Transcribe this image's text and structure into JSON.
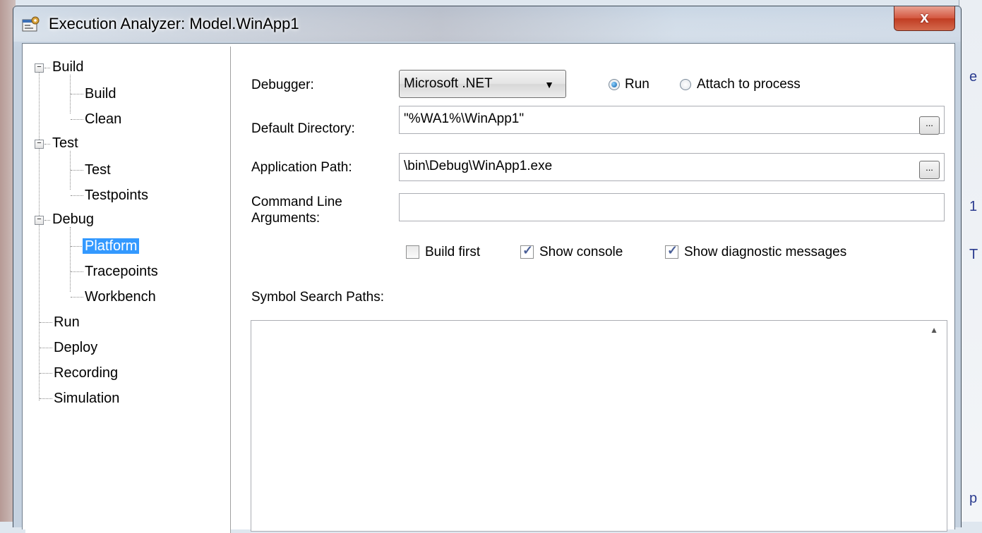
{
  "window": {
    "title": "Execution Analyzer: Model.WinApp1",
    "close_label": "x"
  },
  "tree": {
    "groups": [
      {
        "label": "Build",
        "children": [
          "Build",
          "Clean"
        ]
      },
      {
        "label": "Test",
        "children": [
          "Test",
          "Testpoints"
        ]
      },
      {
        "label": "Debug",
        "children": [
          "Platform",
          "Tracepoints",
          "Workbench"
        ]
      }
    ],
    "leaves": [
      "Run",
      "Deploy",
      "Recording",
      "Simulation"
    ],
    "selected": "Platform"
  },
  "form": {
    "debugger_label": "Debugger:",
    "debugger_value": "Microsoft .NET",
    "run_label": "Run",
    "attach_label": "Attach to process",
    "run_selected": true,
    "default_dir_label": "Default Directory:",
    "default_dir_value": "\"%WA1%\\WinApp1\"",
    "app_path_label": "Application Path:",
    "app_path_value": "\\bin\\Debug\\WinApp1.exe",
    "cmd_args_label_1": "Command Line",
    "cmd_args_label_2": "Arguments:",
    "cmd_args_value": "",
    "browse_label": "...",
    "build_first_label": "Build first",
    "build_first_checked": false,
    "show_console_label": "Show console",
    "show_console_checked": true,
    "show_diag_label": "Show diagnostic messages",
    "show_diag_checked": true,
    "symbol_paths_label": "Symbol Search Paths:",
    "symbol_paths_value": ""
  },
  "background_marks": [
    "e",
    "1",
    "T",
    "p"
  ]
}
